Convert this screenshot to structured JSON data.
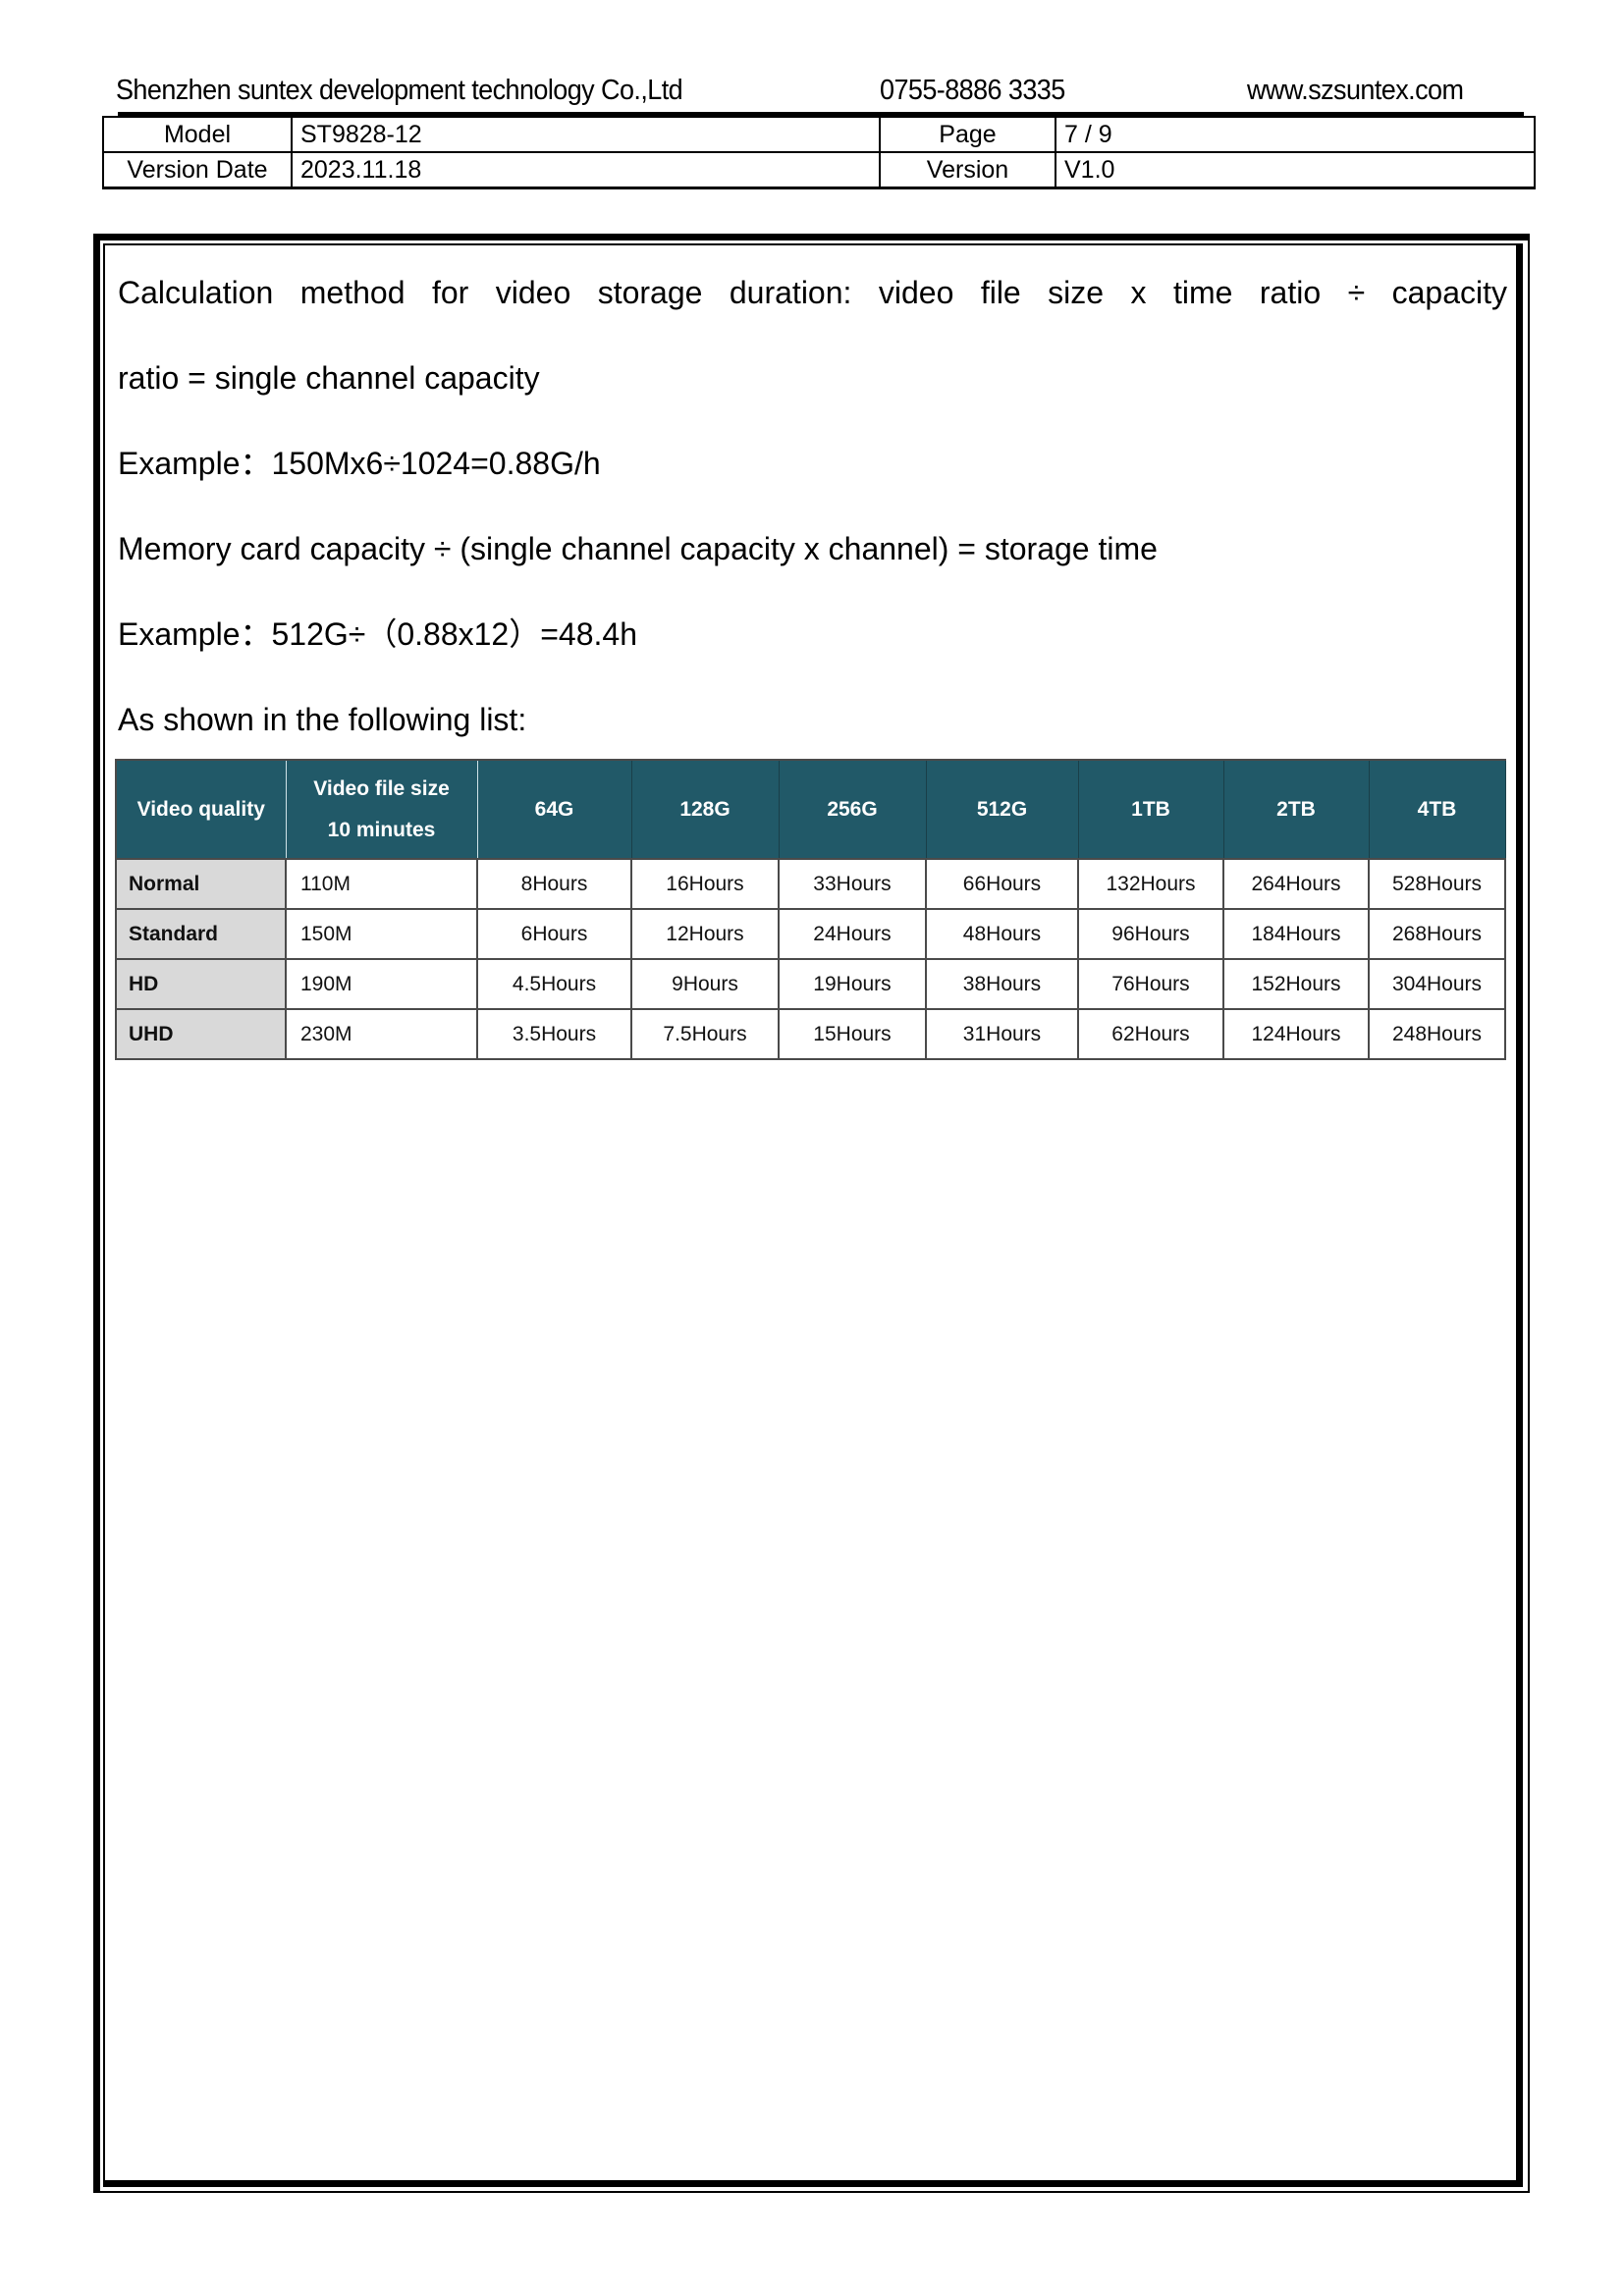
{
  "header": {
    "company": "Shenzhen suntex development technology Co.,Ltd",
    "phone": "0755-8886 3335",
    "website": "www.szsuntex.com"
  },
  "meta": {
    "model_label": "Model",
    "model_value": "ST9828-12",
    "page_label": "Page",
    "page_value": "7 / 9",
    "version_date_label": "Version Date",
    "version_date_value": "2023.11.18",
    "version_label": "Version",
    "version_value": "V1.0"
  },
  "body": {
    "lines": [
      "Calculation method for video storage duration: video file size x time ratio  ÷  capacity",
      "ratio = single channel capacity",
      "Example：150Mx6÷1024=0.88G/h",
      "Memory card capacity  ÷  (single channel capacity x channel) = storage time",
      "Example：512G÷（0.88x12）=48.4h",
      "As shown in the following list:"
    ]
  },
  "table": {
    "header": {
      "quality": "Video quality",
      "size_line1": "Video file size",
      "size_line2": "10 minutes",
      "capacities": [
        "64G",
        "128G",
        "256G",
        "512G",
        "1TB",
        "2TB",
        "4TB"
      ]
    },
    "rows": [
      {
        "quality": "Normal",
        "size": "110M",
        "hours": [
          "8Hours",
          "16Hours",
          "33Hours",
          "66Hours",
          "132Hours",
          "264Hours",
          "528Hours"
        ]
      },
      {
        "quality": "Standard",
        "size": "150M",
        "hours": [
          "6Hours",
          "12Hours",
          "24Hours",
          "48Hours",
          "96Hours",
          "184Hours",
          "268Hours"
        ]
      },
      {
        "quality": "HD",
        "size": "190M",
        "hours": [
          "4.5Hours",
          "9Hours",
          "19Hours",
          "38Hours",
          "76Hours",
          "152Hours",
          "304Hours"
        ]
      },
      {
        "quality": "UHD",
        "size": "230M",
        "hours": [
          "3.5Hours",
          "7.5Hours",
          "15Hours",
          "31Hours",
          "62Hours",
          "124Hours",
          "248Hours"
        ]
      }
    ]
  },
  "colors": {
    "header_fill": "#215968",
    "quality_fill": "#d9d9d9"
  }
}
